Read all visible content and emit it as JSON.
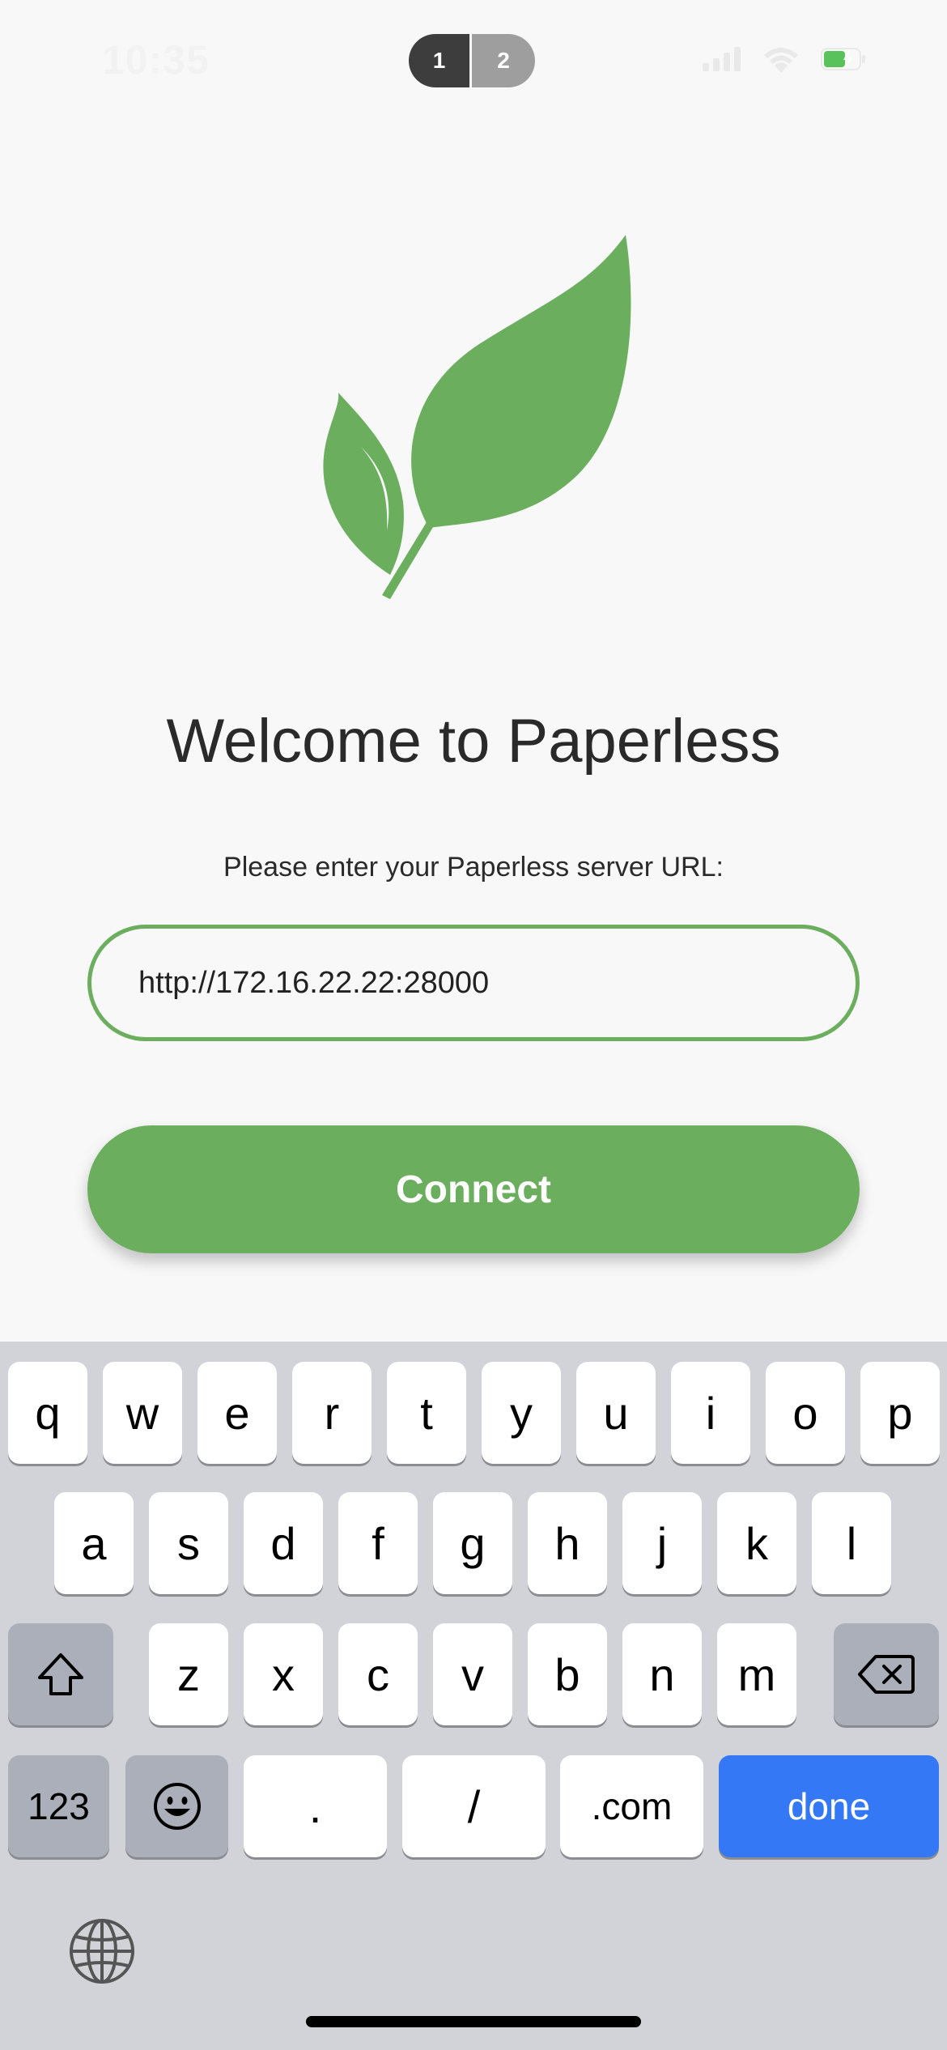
{
  "status_bar": {
    "time": "10:35",
    "page_indicator": [
      "1",
      "2"
    ]
  },
  "colors": {
    "accent": "#6aae5e",
    "keyboard_bg": "#d1d3d9",
    "done_key": "#3478f6"
  },
  "welcome": {
    "title": "Welcome to Paperless",
    "prompt": "Please enter your Paperless server URL:"
  },
  "url_input": {
    "value": "http://172.16.22.22:28000"
  },
  "connect_button": {
    "label": "Connect"
  },
  "keyboard": {
    "row1": [
      "q",
      "w",
      "e",
      "r",
      "t",
      "y",
      "u",
      "i",
      "o",
      "p"
    ],
    "row2": [
      "a",
      "s",
      "d",
      "f",
      "g",
      "h",
      "j",
      "k",
      "l"
    ],
    "row3": [
      "z",
      "x",
      "c",
      "v",
      "b",
      "n",
      "m"
    ],
    "row4": {
      "numbers": "123",
      "dot": ".",
      "slash": "/",
      "dotcom": ".com",
      "done": "done"
    },
    "icons": [
      "shift-icon",
      "backspace-icon",
      "emoji-icon",
      "globe-icon"
    ]
  }
}
